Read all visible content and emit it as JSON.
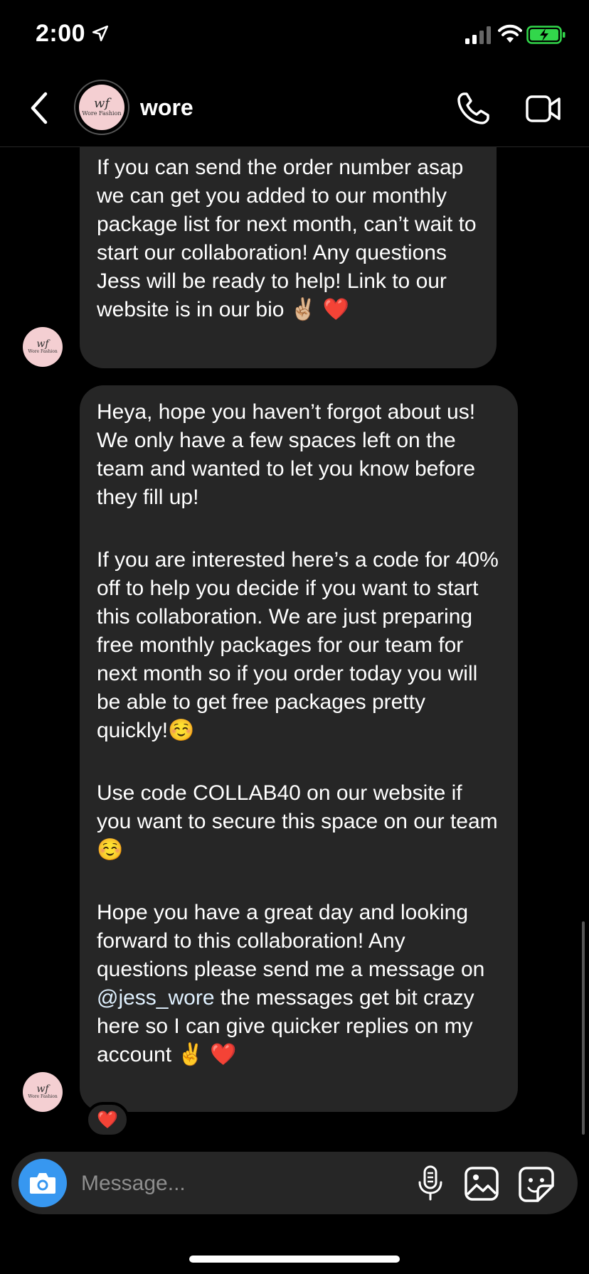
{
  "status_bar": {
    "time": "2:00"
  },
  "header": {
    "title": "wore",
    "avatar_monogram": "wf",
    "avatar_brand": "Wore Fashion"
  },
  "messages": [
    {
      "paragraphs": [
        "If you can send the order number asap we can get you added to our monthly package list for next month, can’t wait to start our collaboration! Any questions Jess will be ready to help! Link to our website is in our bio ✌🏼 ❤️"
      ]
    },
    {
      "paragraphs": [
        "Heya, hope you haven’t forgot about us! We only have a few spaces left on the team and wanted to let you know before they fill up!",
        "If you are interested here’s a code for 40% off to help you decide if you want to start this collaboration. We are just preparing free monthly packages for our team for next month so if you order today you will be able to get free packages pretty quickly!☺️",
        "Use code COLLAB40 on our website if you want to secure this space on our team☺️"
      ],
      "last": {
        "before": "Hope you have a great day and looking forward to this collaboration! Any questions please send me a message on ",
        "mention": "@jess_wore",
        "after": " the messages get bit crazy here so I can give quicker replies on my account ✌️ ❤️"
      },
      "reaction": "❤️"
    }
  ],
  "composer": {
    "placeholder": "Message..."
  },
  "colors": {
    "bubble": "#262626",
    "accent": "#3797f0",
    "mention": "#e0f1ff"
  }
}
